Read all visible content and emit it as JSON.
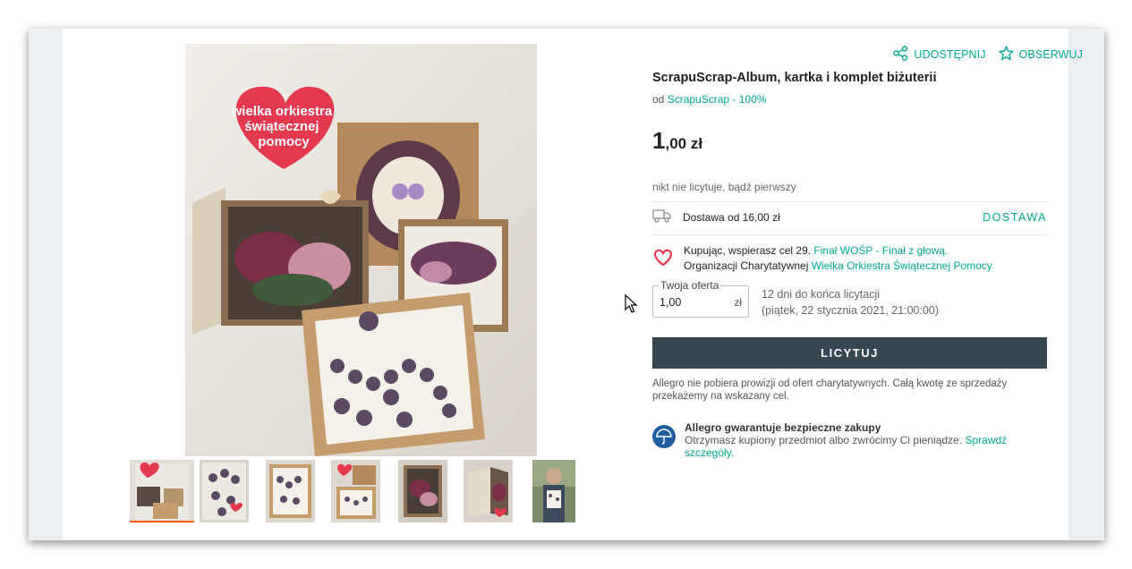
{
  "actions": {
    "share": "UDOSTĘPNIJ",
    "watch": "OBSERWUJ"
  },
  "offer_title": "ScrapuScrap-Album, kartka i komplet biżuterii",
  "seller": {
    "prefix": "od",
    "name": "ScrapuScrap - 100%"
  },
  "price": {
    "int": "1",
    "dec": ",00 zł"
  },
  "no_bids": "nikt nie licytuje, bądź pierwszy",
  "delivery": {
    "text": "Dostawa od 16,00 zł",
    "link": "DOSTAWA"
  },
  "charity": {
    "line1_prefix": "Kupując, wspierasz cel 29.",
    "line1_link": "Finał WOŚP - Finał z głową.",
    "line2_prefix": "Organizacji Charytatywnej",
    "line2_link": "Wielka Orkiestra Świątecznej Pomocy"
  },
  "bid_input": {
    "legend": "Twoja oferta",
    "value": "1,00",
    "currency": "zł"
  },
  "time_left": {
    "line1": "12 dni do końca licytacji",
    "line2": "(piątek, 22 stycznia 2021, 21:00:00)"
  },
  "bid_button": "LICYTUJ",
  "note": "Allegro nie pobiera prowizji od ofert charytatywnych. Całą kwotę ze sprzedaży przekażemy na wskazany cel.",
  "guarantee": {
    "head": "Allegro gwarantuje bezpieczne zakupy",
    "body": "Otrzymasz kupiony przedmiot albo zwrócimy Ci pieniądze.",
    "link": "Sprawdź szczegóły."
  },
  "photo": {
    "heart_text": [
      "wielka orkiestra",
      "świątecznej",
      "pomocy"
    ]
  },
  "thumbnails": 7,
  "colors": {
    "accent": "#00a790",
    "button": "#37474f",
    "active_thumb": "#ff5a00",
    "heart": "#e53950"
  }
}
